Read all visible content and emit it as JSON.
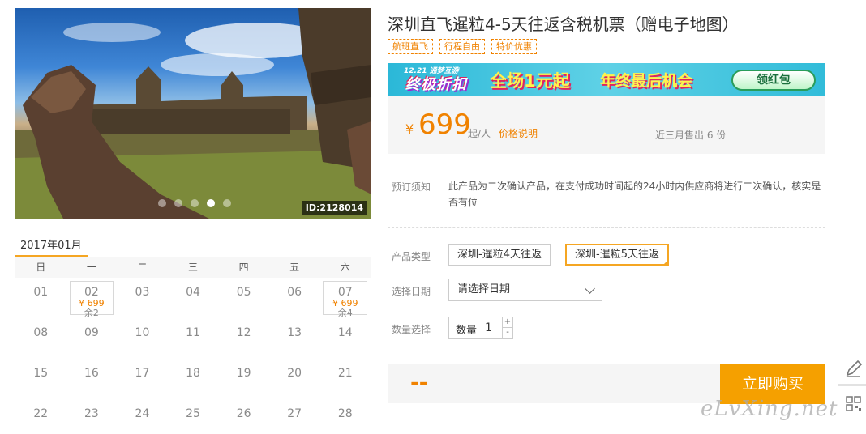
{
  "photo": {
    "id_label": "ID:2128014",
    "dot_count": 5,
    "active_dot": 3
  },
  "calendar": {
    "month": "2017年01月",
    "weekdays": [
      "日",
      "一",
      "二",
      "三",
      "四",
      "五",
      "六"
    ],
    "rows": [
      [
        {
          "d": "01"
        },
        {
          "d": "02",
          "price": "¥ 699",
          "left": "余2"
        },
        {
          "d": "03"
        },
        {
          "d": "04"
        },
        {
          "d": "05"
        },
        {
          "d": "06"
        },
        {
          "d": "07",
          "price": "¥ 699",
          "left": "余4"
        }
      ],
      [
        {
          "d": "08"
        },
        {
          "d": "09"
        },
        {
          "d": "10"
        },
        {
          "d": "11"
        },
        {
          "d": "12"
        },
        {
          "d": "13"
        },
        {
          "d": "14"
        }
      ],
      [
        {
          "d": "15"
        },
        {
          "d": "16"
        },
        {
          "d": "17"
        },
        {
          "d": "18"
        },
        {
          "d": "19"
        },
        {
          "d": "20"
        },
        {
          "d": "21"
        }
      ],
      [
        {
          "d": "22"
        },
        {
          "d": "23"
        },
        {
          "d": "24"
        },
        {
          "d": "25"
        },
        {
          "d": "26"
        },
        {
          "d": "27"
        },
        {
          "d": "28"
        }
      ]
    ]
  },
  "product": {
    "title": "深圳直飞暹粒4-5天往返含税机票（赠电子地图）",
    "tags": [
      "航班直飞",
      "行程自由",
      "特价优惠"
    ]
  },
  "banner": {
    "date": "12.21 通梦互游",
    "slogan": "终极折扣",
    "promo1": "全场1元起",
    "promo2": "年终最后机会",
    "button": "领红包"
  },
  "price": {
    "currency": "¥",
    "amount": "699",
    "unit": "起/人",
    "explain_link": "价格说明",
    "sold": "近三月售出 6 份"
  },
  "notice": {
    "label": "预订须知",
    "text": "此产品为二次确认产品，在支付成功时间起的24小时内供应商将进行二次确认，核实是否有位"
  },
  "options": {
    "type_label": "产品类型",
    "types": [
      "深圳-暹粒4天往返",
      "深圳-暹粒5天往返"
    ],
    "selected_type": 1,
    "date_label": "选择日期",
    "date_placeholder": "请选择日期",
    "qty_label": "数量选择",
    "qty_prefix": "数量",
    "qty_value": "1",
    "qty_plus": "+",
    "qty_minus": "-"
  },
  "buy": {
    "total": "--",
    "button": "立即购买"
  },
  "watermark": "eLvXing.net",
  "colors": {
    "accent": "#f5a000",
    "price": "#f08200"
  }
}
